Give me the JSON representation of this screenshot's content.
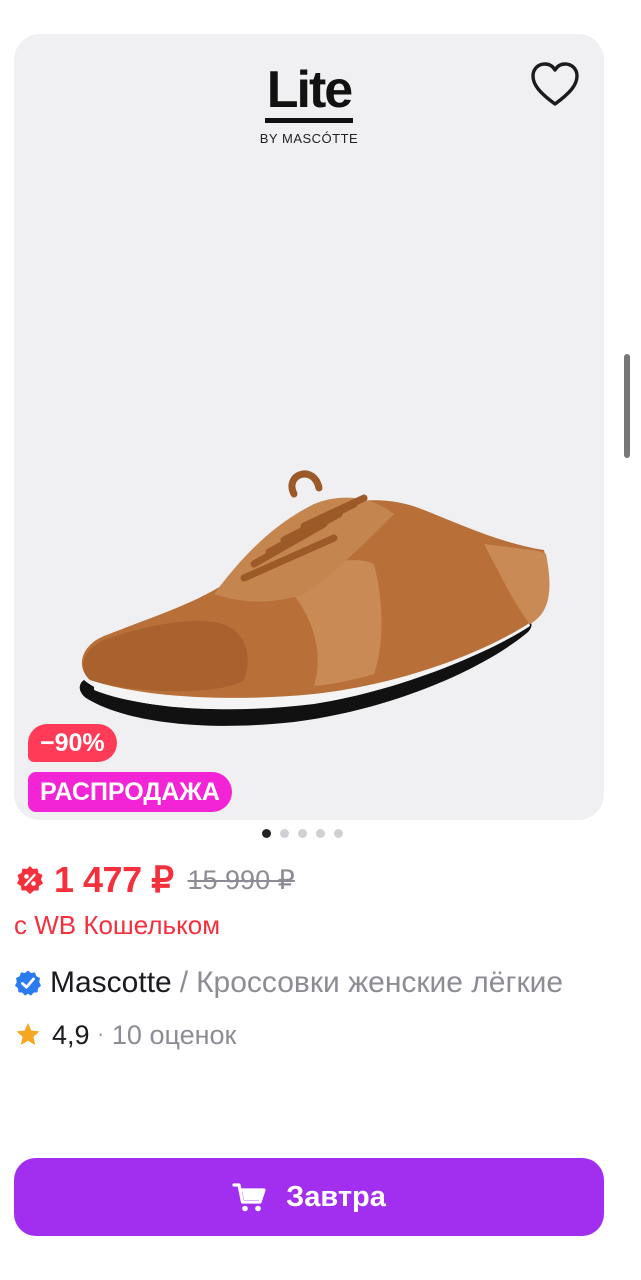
{
  "product_card": {
    "logo": {
      "main": "Lite",
      "sub": "BY MASCÓTTE"
    },
    "favorite_icon": "heart-icon",
    "badges": {
      "discount": "−90%",
      "sale": "РАСПРОДАЖА"
    },
    "carousel": {
      "count": 5,
      "active_index": 0
    }
  },
  "price": {
    "current": "1 477 ₽",
    "old": "15 990 ₽",
    "wallet_note": "с WB Кошельком",
    "wallet_icon": "wallet-discount-icon"
  },
  "title": {
    "brand": "Mascotte",
    "separator": "/",
    "name": "Кроссовки женские лёгкие",
    "verified_icon": "verified-check-icon"
  },
  "rating": {
    "value": "4,9",
    "separator": "·",
    "reviews": "10 оценок",
    "icon": "star-icon"
  },
  "action": {
    "label": "Завтра",
    "icon": "cart-icon"
  },
  "colors": {
    "price": "#f4303d",
    "discount_badge": "#ff3b57",
    "sale_badge": "#f224d5",
    "button": "#a22ff0",
    "verified": "#2b7bf0",
    "star": "#f5a623"
  }
}
